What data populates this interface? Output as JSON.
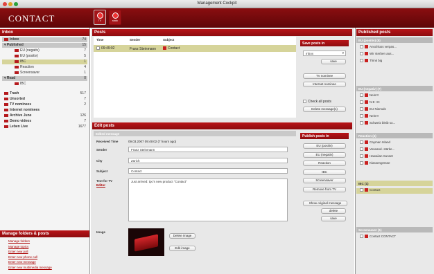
{
  "window": {
    "title": "Management Cockpit"
  },
  "toolbar": {
    "logo": "CONTACT",
    "btn_tv": "TV",
    "btn_static": "static"
  },
  "inbox": {
    "header": "Inbox",
    "items": [
      {
        "label": "Inbox",
        "count": "74"
      },
      {
        "label": "Published",
        "count": "15"
      },
      {
        "label": "EU (negativ)",
        "count": "7"
      },
      {
        "label": "EU (positiv)",
        "count": "5"
      },
      {
        "label": "IBC",
        "count": "1"
      },
      {
        "label": "Reaction",
        "count": "4"
      },
      {
        "label": "Screensaver",
        "count": "1"
      },
      {
        "label": "Read",
        "count": "0"
      },
      {
        "label": "IBC",
        "count": ""
      },
      {
        "label": "Trash",
        "count": "517"
      },
      {
        "label": "Unsorted",
        "count": "7"
      },
      {
        "label": "TV nominees",
        "count": "2"
      },
      {
        "label": "Internet nominees",
        "count": ""
      },
      {
        "label": "Archive June",
        "count": "126"
      },
      {
        "label": "Demo videos",
        "count": "7"
      },
      {
        "label": "Leben Live",
        "count": "1677"
      }
    ]
  },
  "manage": {
    "header": "Manage folders & posts",
    "links": [
      "Manage folders",
      "Manage topics",
      "Enter new poll",
      "Enter new phone call",
      "Enter new message",
      "Enter new multimedia message"
    ]
  },
  "posts": {
    "header": "Posts",
    "columns": [
      "Time",
      "Sender",
      "Subject"
    ],
    "rows": [
      {
        "time": "09:49:02",
        "sender": "Franz Steinmann",
        "subject": "Contact"
      }
    ]
  },
  "save_posts": {
    "header": "Save posts in",
    "select": "Inbox",
    "save": "save",
    "tv": "TV nominee",
    "internet": "Internet nominee",
    "check_all": "Check all posts",
    "delete": "Delete message(s)"
  },
  "edit_posts": {
    "header": "Edit posts",
    "sub": "Edited message",
    "received_label": "Received Time",
    "received": "09.03.2007 09:49:02 (7 hours ago)",
    "sender_label": "Sender",
    "sender": "Franz Steinmann",
    "city_label": "City",
    "city": "Zürich",
    "subject_label": "Subject",
    "subject": "Contact",
    "text_label": "Text for TV",
    "editor_label": "Editor",
    "text": "Just arrived: tpc's new product \"Contact\"",
    "image_label": "Image",
    "delete_image": "Delete image",
    "edit_image": "Edit image"
  },
  "publish": {
    "header": "Publish posts in",
    "buttons": [
      "EU (positiv)",
      "EU (negativ)",
      "Reaction",
      "IBC",
      "Screensaver",
      "Remove from TV"
    ],
    "show_original": "Show original message",
    "delete": "delete",
    "save": "save"
  },
  "published": {
    "header": "Published posts",
    "sections": [
      {
        "title": "EU (positiv) (5)",
        "items": [
          "Anschluss verpas...",
          "Wir sterben aus...",
          "Think big"
        ]
      },
      {
        "title": "EU (negativ) (7)",
        "items": [
          "Nein!!!",
          "N E I N",
          "EU Niemals",
          "Nein!!!",
          "Schweiz bleib so..."
        ]
      },
      {
        "title": "Reaction (4)",
        "items": [
          "Cayman Island",
          "Verwand- stärke...",
          "Hawaiian Sunset",
          "Klassengrösse"
        ]
      },
      {
        "title": "IBC (1)",
        "items": [
          "Contact"
        ]
      },
      {
        "title": "Screensaver (1)",
        "items": [
          "Contact CONTACT"
        ]
      }
    ]
  }
}
